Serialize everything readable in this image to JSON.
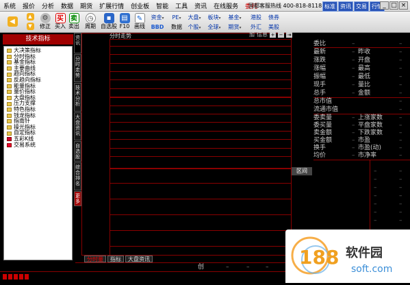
{
  "menu": [
    "系统",
    "报价",
    "分析",
    "数据",
    "期货",
    "扩展行情",
    "创业板",
    "智能",
    "工具",
    "资讯",
    "在线服务",
    "委托"
  ],
  "hotline": "国都客服热线 400-818-8118",
  "top_buttons": [
    "标准",
    "资讯",
    "交易",
    "行情"
  ],
  "window_controls": [
    "_",
    "□",
    "×"
  ],
  "toolbar": {
    "back": "",
    "forward": "",
    "fix": "修正",
    "buy": "买入",
    "sell": "卖出",
    "buy_glyph": "买",
    "sell_glyph": "卖",
    "period": "周期",
    "select": "自选股",
    "f10": "F10",
    "draw": "画线",
    "fund": "资金",
    "bbd": "BBD",
    "data": "数据",
    "pe": "PE",
    "dapan": "大盘",
    "ge": "个股",
    "bankuai": "板块",
    "quanqiu": "全球",
    "jijin": "基金",
    "qihuo": "期货",
    "gangu": "港股",
    "waihui": "外汇",
    "zhaiquan": "债券",
    "meigu": "美股"
  },
  "left_panel": {
    "title": "技术指标",
    "items": [
      "大决策指标",
      "分时指标",
      "基金指标",
      "主要曲线",
      "趋向指标",
      "反趋向指标",
      "能量指标",
      "量价指标",
      "大盘指标",
      "压力支撑",
      "特色指标",
      "钱龙指标",
      "指南针",
      "操光指标",
      "自定指标",
      "五彩K线",
      "交易系统"
    ]
  },
  "vtabs": [
    "资讯",
    "分时走势",
    "技术分析",
    "大盘资讯",
    "自选股",
    "综合排名",
    "更多"
  ],
  "chart": {
    "title": "分时走势",
    "controls": {
      "add": "加",
      "info": "信息",
      "plus": "+",
      "minus": "−",
      "arrow": "⇥"
    }
  },
  "mid_button": "区间",
  "quote": {
    "weibi": "委比",
    "rows": [
      [
        "最新",
        "昨收"
      ],
      [
        "涨跌",
        "开盘"
      ],
      [
        "涨幅",
        "最高"
      ],
      [
        "振幅",
        "最低"
      ],
      [
        "现手",
        "量比"
      ],
      [
        "总手",
        "金额"
      ]
    ],
    "total_value": "总市值",
    "float_value": "流通市值",
    "rows2": [
      [
        "委卖量",
        "上涨家数"
      ],
      [
        "委买量",
        "平盘家数"
      ],
      [
        "卖金额",
        "下跌家数"
      ],
      [
        "买金额",
        "市盈"
      ],
      [
        "换手",
        "市盈(动)"
      ],
      [
        "均价",
        "市净率"
      ]
    ],
    "dash": "–"
  },
  "bottom_tabs": [
    "分时量",
    "指标",
    "大盘资讯"
  ],
  "bottom": {
    "chuang": "创",
    "dash": "–"
  }
}
